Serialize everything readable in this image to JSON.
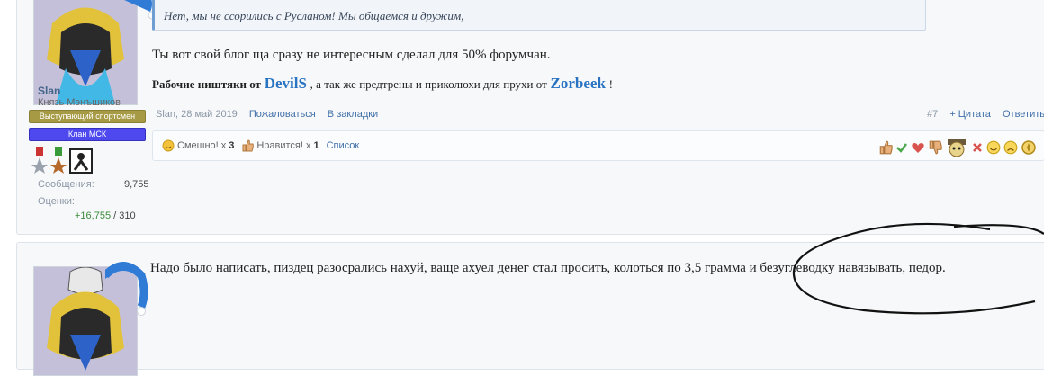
{
  "post1": {
    "quote_text": "Нет, мы не ссорились с Русланом! Мы общаемся и дружим,",
    "message_line1": "Ты вот свой блог ща сразу не интересным сделал для 50% форумчан.",
    "sig": {
      "prefix": "Рабочие ништяки от",
      "author1": "DevilS",
      "middle": ", а так же предтрены и приколюхи для прухи от",
      "author2": "Zorbeek",
      "suffix": "!"
    },
    "meta": {
      "author": "Slan",
      "date": "28 май 2019",
      "report_label": "Пожаловаться",
      "bookmark_label": "В закладки",
      "post_number": "#7",
      "quote_label": "+ Цитата",
      "reply_label": "Ответить"
    },
    "reactions": {
      "funny_label": "Смешно!",
      "funny_x": "x",
      "funny_count": "3",
      "like_label": "Нравится!",
      "like_x": "x",
      "like_count": "1",
      "list_label": "Список"
    },
    "user": {
      "name": "Slan",
      "title": "Князь Мэнъшиков",
      "banner_athlete": "Выступающий спортсмен",
      "banner_clan": "Клан МСК",
      "messages_label": "Сообщения:",
      "messages_value": "9,755",
      "ratings_label": "Оценки:",
      "ratings_value": "+16,755",
      "ratings_total": "/ 310"
    }
  },
  "post2": {
    "message": "Надо было написать, пиздец разосрались нахуй, ваще ахуел денег стал просить, колоться по 3,5 грамма и безуглеводку навязывать, педор."
  },
  "icons": [
    "smile-icon",
    "thumb-up-icon",
    "thumbs-up-rate-icon",
    "check-icon",
    "heart-icon",
    "thumbs-down-icon",
    "face-hat-icon",
    "x-icon",
    "smiley-icon",
    "sad-icon",
    "compass-icon",
    "medal-icon"
  ]
}
